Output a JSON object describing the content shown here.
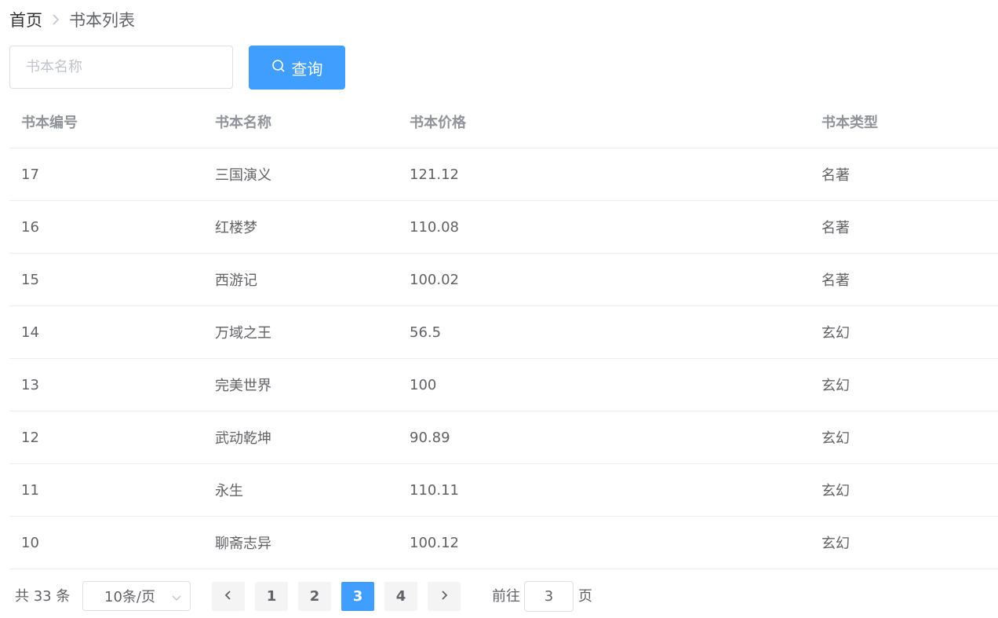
{
  "breadcrumb": {
    "home": "首页",
    "current": "书本列表"
  },
  "search": {
    "placeholder": "书本名称",
    "value": "",
    "button_label": "查询"
  },
  "table": {
    "columns": [
      "书本编号",
      "书本名称",
      "书本价格",
      "书本类型"
    ],
    "rows": [
      [
        "17",
        "三国演义",
        "121.12",
        "名著"
      ],
      [
        "16",
        "红楼梦",
        "110.08",
        "名著"
      ],
      [
        "15",
        "西游记",
        "100.02",
        "名著"
      ],
      [
        "14",
        "万域之王",
        "56.5",
        "玄幻"
      ],
      [
        "13",
        "完美世界",
        "100",
        "玄幻"
      ],
      [
        "12",
        "武动乾坤",
        "90.89",
        "玄幻"
      ],
      [
        "11",
        "永生",
        "110.11",
        "玄幻"
      ],
      [
        "10",
        "聊斋志异",
        "100.12",
        "玄幻"
      ]
    ]
  },
  "pagination": {
    "total_label": "共 33 条",
    "page_size_label": "10条/页",
    "pages": [
      "1",
      "2",
      "3",
      "4"
    ],
    "current_page": "3",
    "goto_prefix": "前往",
    "goto_value": "3",
    "goto_suffix": "页"
  },
  "colors": {
    "accent": "#409eff",
    "border": "#dcdfe6",
    "row_divider": "#ebeef5",
    "pager_bg": "#f4f4f5"
  }
}
